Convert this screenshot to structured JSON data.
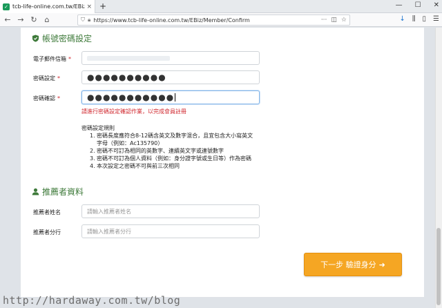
{
  "browser": {
    "tab_title": "tcb-life-online.com.tw/EBiz/M",
    "tab_close": "×",
    "new_tab": "+",
    "url": "https://www.tcb-life-online.com.tw/EBiz/Member/Confirm",
    "url_more": "···",
    "window_controls": [
      "—",
      "☐",
      "✕"
    ]
  },
  "account_section": {
    "title": "帳號密碼設定",
    "email_label": "電子郵件信箱",
    "password_label": "密碼設定",
    "password_value": "●●●●●●●●●●",
    "confirm_label": "密碼確認",
    "confirm_value": "●●●●●●●●●●●",
    "required_mark": "*",
    "error_text": "請進行密碼設定確認作業，以完成會員註冊"
  },
  "rules": {
    "title": "密碼設定規則",
    "items": [
      {
        "num": "1.",
        "text": "密碼長度應符合8-12碼含英文及數字混合，且宜包含大小寫英文",
        "cont": "字母（例如：Ac135790）"
      },
      {
        "num": "2.",
        "text": "密碼不可訂為相同的英數字、連續英文字或連號數字",
        "cont": ""
      },
      {
        "num": "3.",
        "text": "密碼不可訂為個人資料（例如：身分證字號或生日等）作為密碼",
        "cont": ""
      },
      {
        "num": "4.",
        "text": "本次設定之密碼不可與前三次相同",
        "cont": ""
      }
    ]
  },
  "referrer_section": {
    "title": "推薦者資料",
    "name_label": "推薦者姓名",
    "name_placeholder": "請輸入推薦者姓名",
    "branch_label": "推薦者分行",
    "branch_placeholder": "請輸入推薦者分行"
  },
  "next_button": {
    "label": "下一步 驗證身分",
    "arrow": "➜"
  },
  "watermark": "http://hardaway.com.tw/blog",
  "colors": {
    "section_green": "#3e7a3a",
    "required_red": "#d0282f",
    "button_orange": "#f5a623"
  }
}
